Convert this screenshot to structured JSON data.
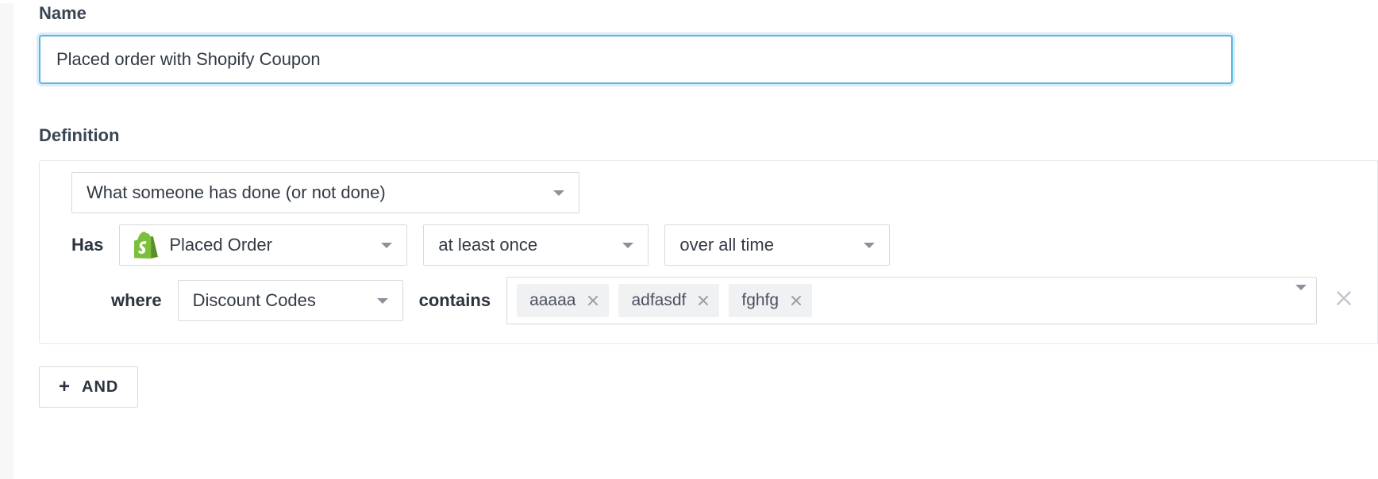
{
  "labels": {
    "name": "Name",
    "definition": "Definition"
  },
  "name_value": "Placed order with Shopify Coupon",
  "definition": {
    "condition_type": "What someone has done (or not done)",
    "has_label": "Has",
    "event": "Placed Order",
    "frequency": "at least once",
    "timeframe": "over all time",
    "where_label": "where",
    "property": "Discount Codes",
    "operator": "contains",
    "values": [
      "aaaaa",
      "adfasdf",
      "fghfg"
    ]
  },
  "and_button_label": "AND"
}
